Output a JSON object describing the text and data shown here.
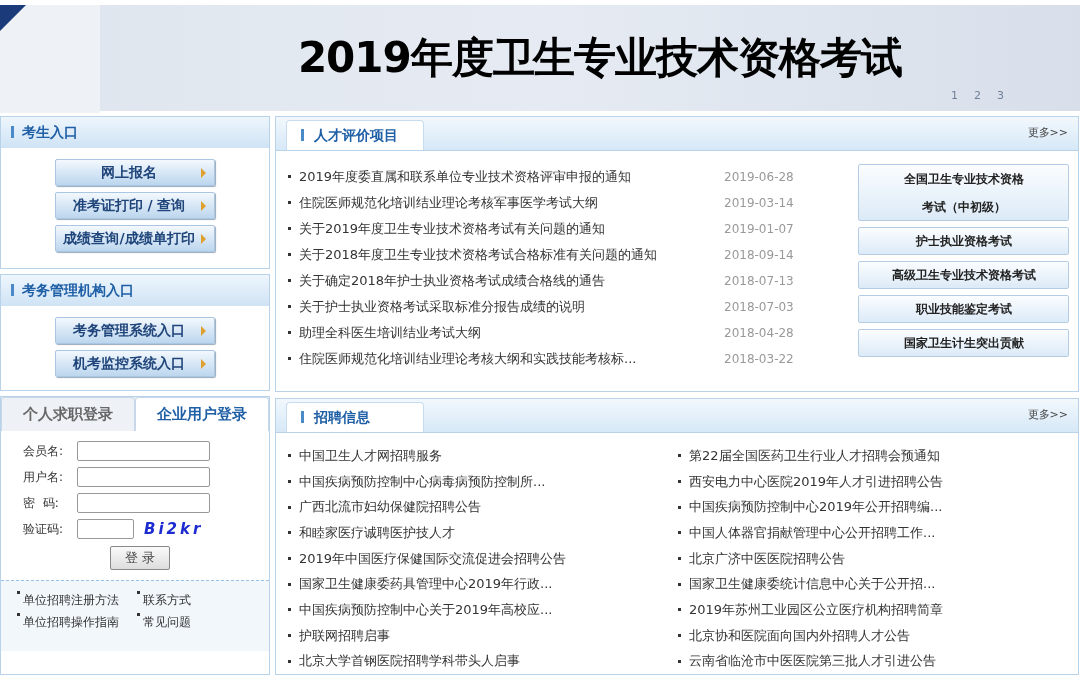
{
  "banner": {
    "title": "2019年度卫生专业技术资格考试",
    "slides": [
      {
        "label": "1",
        "selected": false
      },
      {
        "label": "2",
        "selected": false
      },
      {
        "label": "3",
        "selected": false
      }
    ]
  },
  "candidate_entry": {
    "title": "考生入口",
    "buttons": [
      "网上报名",
      "准考证打印 / 查询",
      "成绩查询/成绩单打印"
    ]
  },
  "admin_entry": {
    "title": "考务管理机构入口",
    "buttons": [
      "考务管理系统入口",
      "机考监控系统入口"
    ]
  },
  "login": {
    "tabs": [
      {
        "label": "个人求职登录",
        "selected": false
      },
      {
        "label": "企业用户登录",
        "selected": true
      }
    ],
    "fields": [
      {
        "label": "会员名:"
      },
      {
        "label": "用户名:"
      },
      {
        "label": "密  码:"
      },
      {
        "label": "验证码:",
        "captcha": "Bi2kr"
      }
    ],
    "submit": "登 录",
    "links": [
      "单位招聘注册方法",
      "联系方式",
      "单位招聘操作指南",
      "常见问题"
    ]
  },
  "evaluation": {
    "tab": "人才评价项目",
    "more": "更多>>",
    "news": [
      {
        "title": "2019年度委直属和联系单位专业技术资格评审申报的通知",
        "date": "2019-06-28"
      },
      {
        "title": "住院医师规范化培训结业理论考核军事医学考试大纲",
        "date": "2019-03-14"
      },
      {
        "title": "关于2019年度卫生专业技术资格考试有关问题的通知",
        "date": "2019-01-07"
      },
      {
        "title": "关于2018年度卫生专业技术资格考试合格标准有关问题的通知",
        "date": "2018-09-14"
      },
      {
        "title": "关于确定2018年护士执业资格考试成绩合格线的通告",
        "date": "2018-07-13"
      },
      {
        "title": "关于护士执业资格考试采取标准分报告成绩的说明",
        "date": "2018-07-03"
      },
      {
        "title": "助理全科医生培训结业考试大纲",
        "date": "2018-04-28"
      },
      {
        "title": "住院医师规范化培训结业理论考核大纲和实践技能考核标...",
        "date": "2018-03-22"
      }
    ],
    "exam_buttons": [
      "全国卫生专业技术资格考试（中初级）",
      "护士执业资格考试",
      "高级卫生专业技术资格考试",
      "职业技能鉴定考试",
      "国家卫生计生突出贡献"
    ]
  },
  "recruitment": {
    "tab": "招聘信息",
    "more": "更多>>",
    "column_1": [
      "中国卫生人才网招聘服务",
      "中国疾病预防控制中心病毒病预防控制所...",
      "广西北流市妇幼保健院招聘公告",
      "和睦家医疗诚聘医护技人才",
      "2019年中国医疗保健国际交流促进会招聘公告",
      "国家卫生健康委药具管理中心2019年行政...",
      "中国疾病预防控制中心关于2019年高校应...",
      "护联网招聘启事",
      "北京大学首钢医院招聘学科带头人启事"
    ],
    "column_2": [
      "第22届全国医药卫生行业人才招聘会预通知",
      "西安电力中心医院2019年人才引进招聘公告",
      "中国疾病预防控制中心2019年公开招聘编...",
      "中国人体器官捐献管理中心公开招聘工作...",
      "北京广济中医医院招聘公告",
      "国家卫生健康委统计信息中心关于公开招...",
      "2019年苏州工业园区公立医疗机构招聘简章",
      "北京协和医院面向国内外招聘人才公告",
      "云南省临沧市中医医院第三批人才引进公告"
    ]
  }
}
